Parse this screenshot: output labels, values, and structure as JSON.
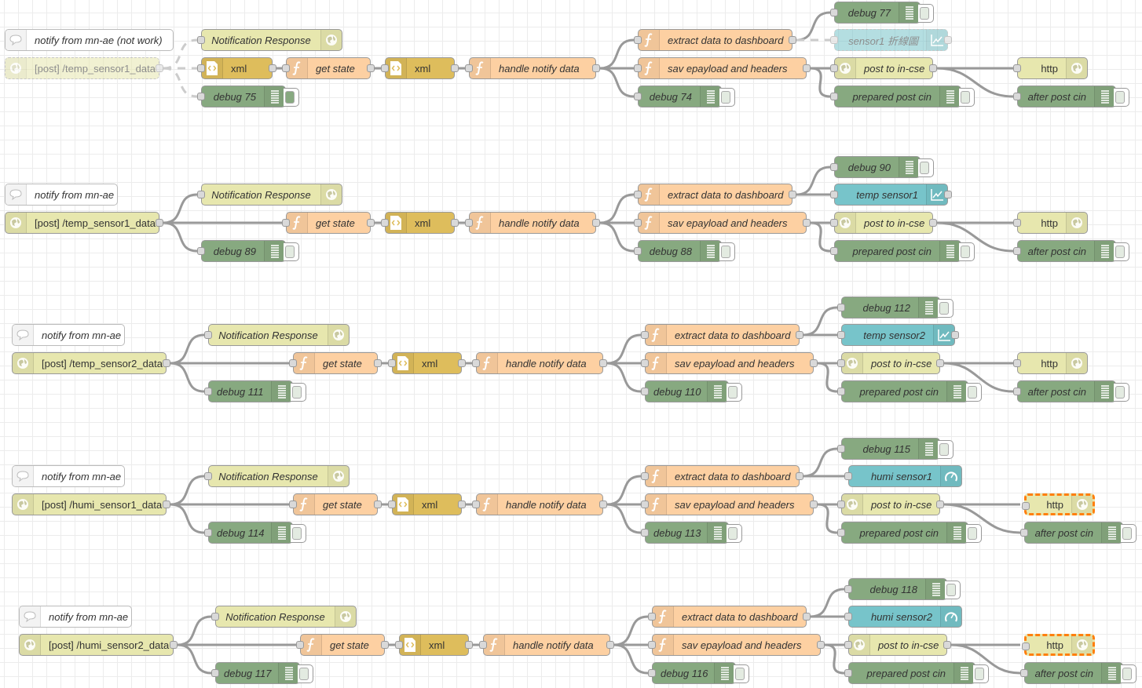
{
  "app": "Node-RED flow editor",
  "colors": {
    "http": "#e7e7ae",
    "function": "#fdd0a2",
    "xml": "#debd5c",
    "debug": "#87a980",
    "dashboard": "#77c4ca",
    "selected_outline": "#ff7f0e",
    "grid": "#ececec"
  },
  "flows": [
    {
      "comment": "notify from mn-ae (not work)",
      "http_in": "[post] /temp_sensor1_data",
      "http_in_disabled": true,
      "response": "Notification Response",
      "xml1": "xml",
      "get_state": "get state",
      "xml2": "xml",
      "handle": "handle notify data",
      "debug_in": "debug 75",
      "debug_in_active": true,
      "extract": "extract data to dashboard",
      "save": "sav epayload and headers",
      "debug_mid": "debug 74",
      "debug_top": "debug 77",
      "dashboard": "sensor1 折線圖",
      "dashboard_icon": "chart-icon",
      "dashboard_disabled": true,
      "post": "post to in-cse",
      "prepared": "prepared post cin",
      "http": "http",
      "http_selected": false,
      "after": "after post cin"
    },
    {
      "comment": "notify from mn-ae",
      "http_in": "[post] /temp_sensor1_data",
      "response": "Notification Response",
      "get_state": "get state",
      "xml2": "xml",
      "handle": "handle notify data",
      "debug_in": "debug 89",
      "extract": "extract data to dashboard",
      "save": "sav epayload and headers",
      "debug_mid": "debug 88",
      "debug_top": "debug 90",
      "dashboard": "temp sensor1",
      "dashboard_icon": "chart-icon",
      "post": "post to in-cse",
      "prepared": "prepared post cin",
      "http": "http",
      "http_selected": false,
      "after": "after post cin"
    },
    {
      "comment": "notify from mn-ae",
      "http_in": "[post] /temp_sensor2_data",
      "response": "Notification Response",
      "get_state": "get state",
      "xml2": "xml",
      "handle": "handle notify data",
      "debug_in": "debug 111",
      "extract": "extract data to dashboard",
      "save": "sav epayload and headers",
      "debug_mid": "debug 110",
      "debug_top": "debug 112",
      "dashboard": "temp sensor2",
      "dashboard_icon": "chart-icon",
      "post": "post to in-cse",
      "prepared": "prepared post cin",
      "http": "http",
      "http_selected": false,
      "after": "after post cin"
    },
    {
      "comment": "notify from mn-ae",
      "http_in": "[post] /humi_sensor1_data",
      "response": "Notification Response",
      "get_state": "get state",
      "xml2": "xml",
      "handle": "handle notify data",
      "debug_in": "debug 114",
      "extract": "extract data to dashboard",
      "save": "sav epayload and headers",
      "debug_mid": "debug 113",
      "debug_top": "debug 115",
      "dashboard": "humi sensor1",
      "dashboard_icon": "gauge-icon",
      "post": "post to in-cse",
      "prepared": "prepared post cin",
      "http": "http",
      "http_selected": true,
      "after": "after post cin"
    },
    {
      "comment": "notify from mn-ae",
      "http_in": "[post] /humi_sensor2_data",
      "response": "Notification Response",
      "get_state": "get state",
      "xml2": "xml",
      "handle": "handle notify data",
      "debug_in": "debug 117",
      "extract": "extract data to dashboard",
      "save": "sav epayload and headers",
      "debug_mid": "debug 116",
      "debug_top": "debug 118",
      "dashboard": "humi sensor2",
      "dashboard_icon": "gauge-icon",
      "post": "post to in-cse",
      "prepared": "prepared post cin",
      "http": "http",
      "http_selected": true,
      "after": "after post cin"
    }
  ]
}
